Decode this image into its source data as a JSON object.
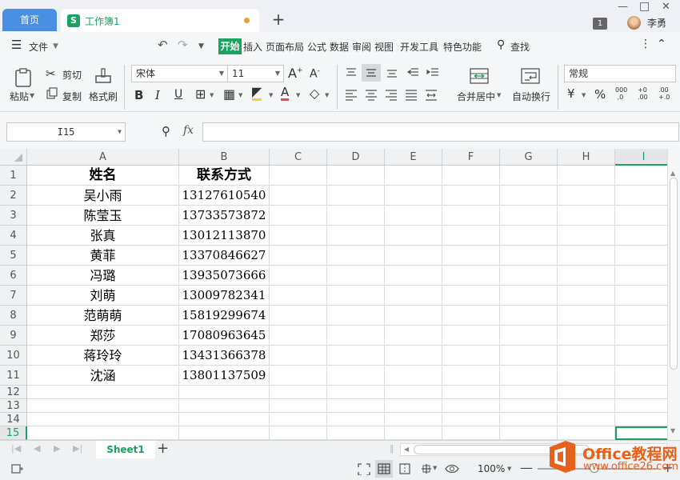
{
  "titlebar": {
    "home_tab": "首页",
    "workbook_tab": "工作簿1",
    "workbook_icon": "S",
    "new_tab": "+",
    "window_count": "1",
    "user_name": "李勇"
  },
  "menu": {
    "file": "文件",
    "items": [
      "开始",
      "插入",
      "页面布局",
      "公式",
      "数据",
      "审阅",
      "视图",
      "开发工具",
      "特色功能"
    ],
    "search": "查找"
  },
  "ribbon": {
    "paste": "粘贴",
    "cut": "剪切",
    "copy": "复制",
    "format_painter": "格式刷",
    "font_name": "宋体",
    "font_size": "11",
    "merge_center": "合并居中",
    "wrap_text": "自动换行",
    "number_format": "常规",
    "percent": "%"
  },
  "formula_bar": {
    "name_box": "I15",
    "fx": "fx",
    "value": ""
  },
  "columns": [
    "A",
    "B",
    "C",
    "D",
    "E",
    "F",
    "G",
    "H",
    "I"
  ],
  "rows": [
    "1",
    "2",
    "3",
    "4",
    "5",
    "6",
    "7",
    "8",
    "9",
    "10",
    "11",
    "12",
    "13",
    "14",
    "15"
  ],
  "table": {
    "headers": [
      "姓名",
      "联系方式"
    ],
    "data": [
      [
        "吴小雨",
        "13127610540"
      ],
      [
        "陈莹玉",
        "13733573872"
      ],
      [
        "张真",
        "13012113870"
      ],
      [
        "黄菲",
        "13370846627"
      ],
      [
        "冯璐",
        "13935073666"
      ],
      [
        "刘萌",
        "13009782341"
      ],
      [
        "范萌萌",
        "15819299674"
      ],
      [
        "郑莎",
        "17080963645"
      ],
      [
        "蒋玲玲",
        "13431366378"
      ],
      [
        "沈涵",
        "13801137509"
      ]
    ]
  },
  "sheet_tabs": {
    "active": "Sheet1",
    "add": "+"
  },
  "status": {
    "zoom": "100%"
  },
  "watermark": {
    "line1": "Office教程网",
    "line2": "www.office26.com"
  },
  "colors": {
    "accent": "#1aa260",
    "home_tab": "#4a90e2",
    "watermark": "#e8611a"
  }
}
